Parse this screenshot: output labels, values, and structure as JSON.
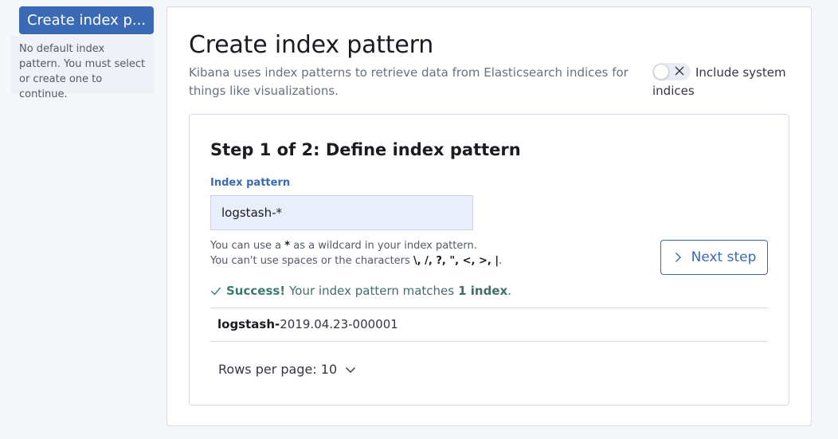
{
  "sidebar": {
    "create_button": "Create index p...",
    "note": "No default index pattern. You must select or create one to continue."
  },
  "main": {
    "title": "Create index pattern",
    "description": "Kibana uses index patterns to retrieve data from Elasticsearch indices for things like visualizations.",
    "toggle_label": "Include system indices",
    "toggle_state": "off"
  },
  "step": {
    "title": "Step 1 of 2: Define index pattern",
    "field_label": "Index pattern",
    "input_value": "logstash-*",
    "help_line1_a": "You can use a ",
    "help_line1_b": "*",
    "help_line1_c": " as a wildcard in your index pattern.",
    "help_line2_a": "You can't use spaces or the characters ",
    "help_line2_b": "\\, /, ?, \", <, >, |",
    "help_line2_c": ".",
    "next_button": "Next step",
    "success_strong": "Success!",
    "success_text": "Your index pattern matches",
    "success_count": "1 index",
    "success_end": ".",
    "match": {
      "prefix": "logstash-",
      "suffix": "2019.04.23-000001"
    },
    "rows_per_page": "Rows per page: 10"
  },
  "icons": {
    "toggle": "cross-icon",
    "next": "chevron-right-icon",
    "success": "check-icon",
    "rows": "chevron-down-icon"
  },
  "colors": {
    "primary": "#3a6ab4",
    "success": "#3a7a73",
    "input_bg": "#e8eefa"
  }
}
